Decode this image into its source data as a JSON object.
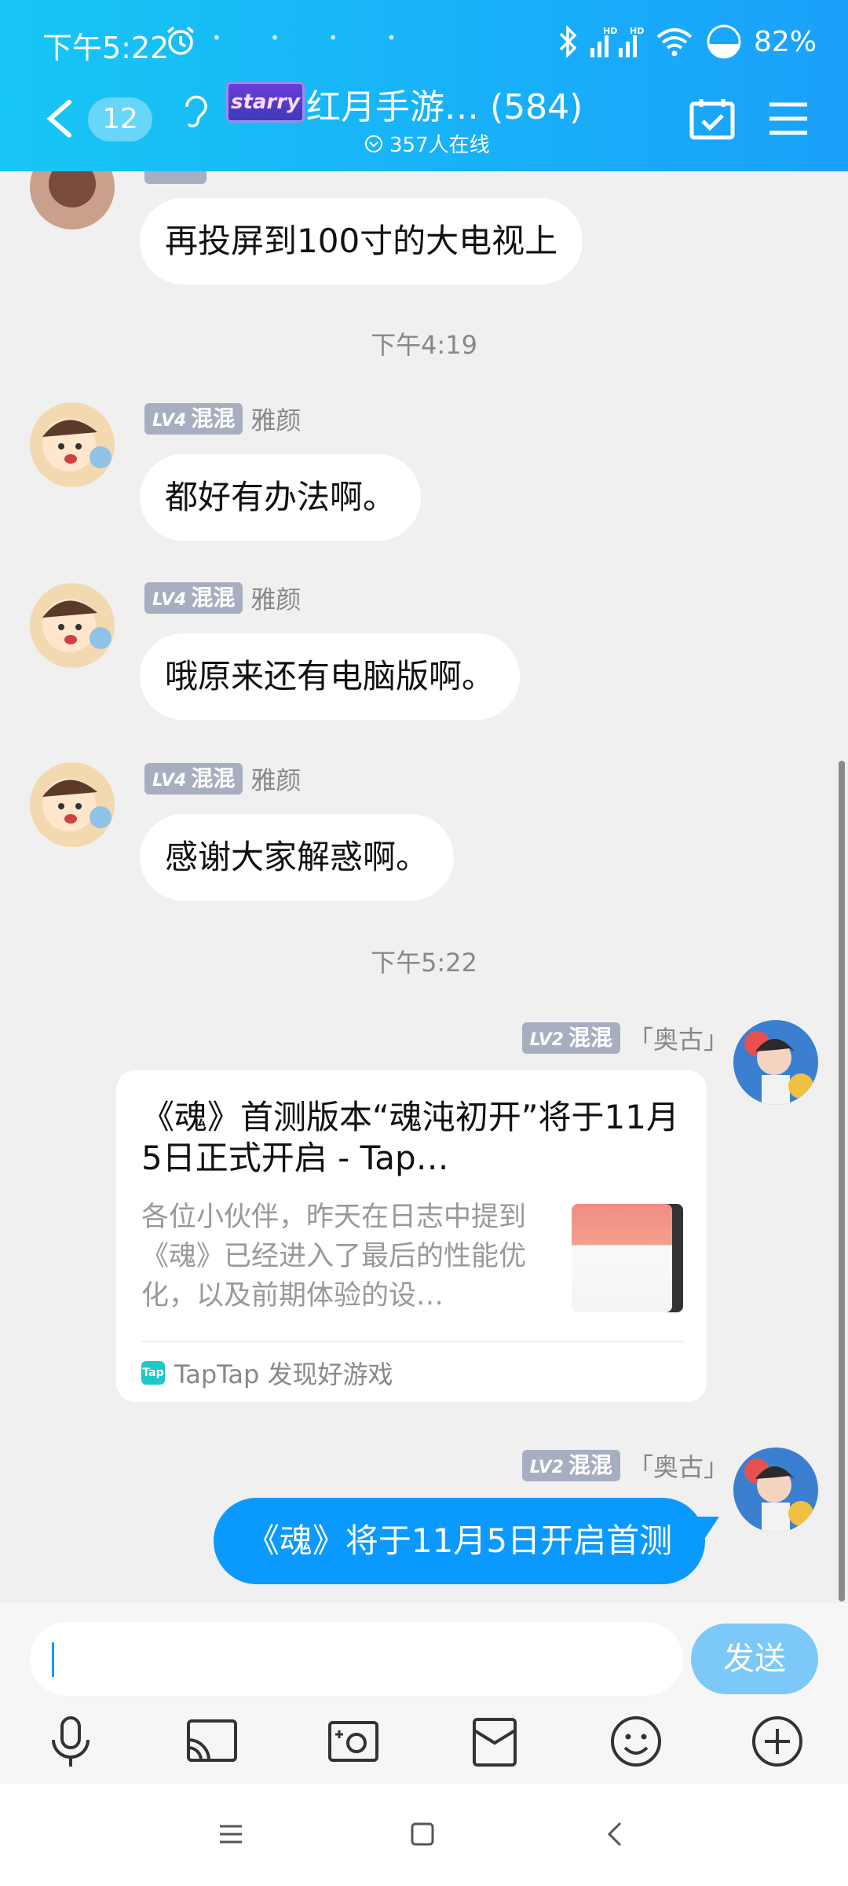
{
  "status_bar": {
    "time": "下午5:22",
    "battery": "82%"
  },
  "header": {
    "back_label": "back",
    "unread_count": "12",
    "group_logo_text": "starry",
    "group_title": "红月手游…  (584)",
    "online_count": "357人在线"
  },
  "messages": [
    {
      "type": "text",
      "sender": "",
      "text": "再投屏到100寸的大电视上"
    },
    {
      "type": "time",
      "text": "下午4:19"
    },
    {
      "type": "text",
      "level": "LV4",
      "title": "混混",
      "sender": "雅颜",
      "text": "都好有办法啊。"
    },
    {
      "type": "text",
      "level": "LV4",
      "title": "混混",
      "sender": "雅颜",
      "text": "哦原来还有电脑版啊。"
    },
    {
      "type": "text",
      "level": "LV4",
      "title": "混混",
      "sender": "雅颜",
      "text": "感谢大家解惑啊。"
    },
    {
      "type": "time",
      "text": "下午5:22"
    },
    {
      "type": "link",
      "level": "LV2",
      "title": "混混",
      "sender": "「奥古」",
      "card_title": "《魂》首测版本“魂沌初开”将于11月5日正式开启 - Tap…",
      "card_desc": "各位小伙伴，昨天在日志中提到《魂》已经进入了最后的性能优化，以及前期体验的设…",
      "card_source": "TapTap 发现好游戏",
      "source_icon_text": "Tap"
    },
    {
      "type": "text",
      "level": "LV2",
      "title": "混混",
      "sender": "「奥古」",
      "text": "《魂》将于11月5日开启首测"
    }
  ],
  "input": {
    "value": "",
    "placeholder": "",
    "send_label": "发送"
  },
  "toolbar": [
    "mic-icon",
    "cast-screen-icon",
    "photo-icon",
    "red-packet-icon",
    "emoji-icon",
    "plus-icon"
  ],
  "colors": {
    "header": "#18b1f8",
    "my_bubble": "#0a99ff",
    "send_button": "#7cc8f8",
    "badge": "#a6aec0"
  }
}
